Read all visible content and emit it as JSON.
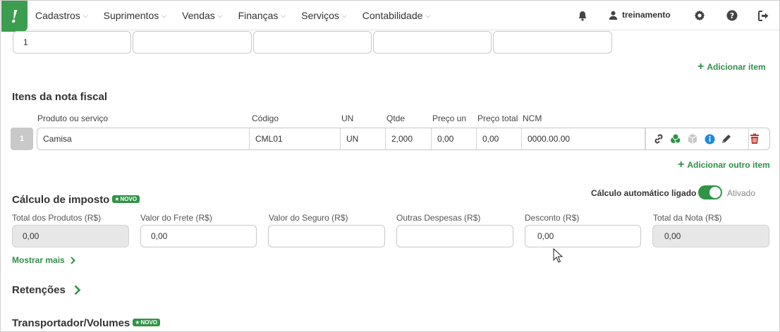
{
  "nav": {
    "logo": "!",
    "menu": [
      {
        "label": "Cadastros"
      },
      {
        "label": "Suprimentos"
      },
      {
        "label": "Vendas"
      },
      {
        "label": "Finanças"
      },
      {
        "label": "Serviços"
      },
      {
        "label": "Contabilidade"
      }
    ],
    "user": "treinamento",
    "icons": [
      "bell-icon",
      "user-icon",
      "gear-icon",
      "help-icon",
      "logout-icon"
    ]
  },
  "top_fields": {
    "values": [
      "1",
      "",
      "",
      "",
      ""
    ],
    "add_item": "Adicionar item"
  },
  "items_section": {
    "title": "Itens da nota fiscal",
    "columns": [
      "Produto ou serviço",
      "Código",
      "UN",
      "Qtde",
      "Preço un",
      "Preço total",
      "NCM"
    ],
    "rows": [
      {
        "num": "1",
        "produto": "Camisa",
        "codigo": "CML01",
        "un": "UN",
        "qtde": "2,000",
        "preco_un": "0,00",
        "preco_total": "0,00",
        "ncm": "0000.00.00"
      }
    ],
    "add_other": "Adicionar outro item",
    "row_icons": [
      "link-icon",
      "coins-icon",
      "box-icon",
      "info-icon",
      "pencil-icon",
      "trash-icon"
    ]
  },
  "tax_section": {
    "title": "Cálculo de imposto",
    "badge": "NOVO",
    "auto_calc_label": "Cálculo automático ligado",
    "toggle_state": "Ativado",
    "fields": [
      {
        "label": "Total dos Produtos (R$)",
        "value": "0,00",
        "readonly": true
      },
      {
        "label": "Valor do Frete (R$)",
        "value": "0,00",
        "readonly": false
      },
      {
        "label": "Valor do Seguro (R$)",
        "value": "",
        "readonly": false
      },
      {
        "label": "Outras Despesas (R$)",
        "value": "",
        "readonly": false
      },
      {
        "label": "Desconto (R$)",
        "value": "0,00",
        "readonly": false
      },
      {
        "label": "Total da Nota (R$)",
        "value": "0,00",
        "readonly": true
      }
    ],
    "show_more": "Mostrar mais"
  },
  "retencoes": {
    "title": "Retenções"
  },
  "transportador": {
    "title": "Transportador/Volumes",
    "badge": "NOVO"
  },
  "colors": {
    "accent": "#2f9447",
    "logo_bg": "#3a9d4f",
    "trash": "#c0392b",
    "info": "#1e88e5"
  }
}
